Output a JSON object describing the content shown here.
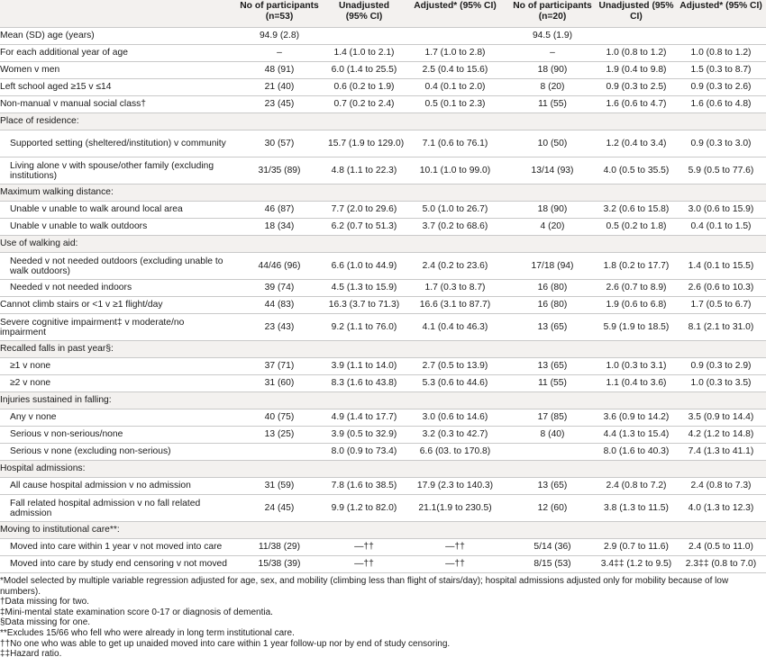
{
  "header": {
    "col1": "No of participants (n=53)",
    "col2": "Unadjusted (95% CI)",
    "col3": "Adjusted* (95% CI)",
    "col4": "No of participants (n=20)",
    "col5": "Unadjusted (95% CI)",
    "col6": "Adjusted* (95% CI)"
  },
  "rows": [
    {
      "label": "Mean (SD) age (years)",
      "type": "plain",
      "c": [
        "94.9 (2.8)",
        "",
        "",
        "94.5 (1.9)",
        "",
        ""
      ]
    },
    {
      "label": "For each additional year of age",
      "type": "plain",
      "c": [
        "–",
        "1.4 (1.0 to 2.1)",
        "1.7 (1.0 to 2.8)",
        "–",
        "1.0 (0.8 to 1.2)",
        "1.0 (0.8 to 1.2)"
      ]
    },
    {
      "label": "Women v men",
      "type": "plain",
      "c": [
        "48 (91)",
        "6.0 (1.4 to 25.5)",
        "2.5 (0.4 to 15.6)",
        "18 (90)",
        "1.9 (0.4 to 9.8)",
        "1.5 (0.3 to 8.7)"
      ]
    },
    {
      "label": "Left school aged ≥15 v ≤14",
      "type": "plain",
      "c": [
        "21 (40)",
        "0.6 (0.2 to 1.9)",
        "0.4 (0.1 to 2.0)",
        "8 (20)",
        "0.9 (0.3 to 2.5)",
        "0.9 (0.3 to 2.6)"
      ]
    },
    {
      "label": "Non-manual v manual social class†",
      "type": "plain",
      "c": [
        "23 (45)",
        "0.7 (0.2 to 2.4)",
        "0.5 (0.1 to 2.3)",
        "11 (55)",
        "1.6 (0.6 to 4.7)",
        "1.6 (0.6 to 4.8)"
      ]
    },
    {
      "label": "Place of residence:",
      "type": "section",
      "c": [
        "",
        "",
        "",
        "",
        "",
        ""
      ]
    },
    {
      "label": "Supported setting (sheltered/institution) v community",
      "type": "ind two",
      "c": [
        "30 (57)",
        "15.7 (1.9 to 129.0)",
        "7.1 (0.6 to 76.1)",
        "10 (50)",
        "1.2 (0.4 to 3.4)",
        "0.9 (0.3 to 3.0)"
      ]
    },
    {
      "label": "Living alone v with spouse/other family (excluding institutions)",
      "type": "ind two",
      "c": [
        "31/35 (89)",
        "4.8 (1.1 to 22.3)",
        "10.1 (1.0 to 99.0)",
        "13/14 (93)",
        "4.0 (0.5 to 35.5)",
        "5.9 (0.5 to 77.6)"
      ]
    },
    {
      "label": "Maximum walking distance:",
      "type": "section",
      "c": [
        "",
        "",
        "",
        "",
        "",
        ""
      ]
    },
    {
      "label": "Unable v unable to walk around local area",
      "type": "ind",
      "c": [
        "46 (87)",
        "7.7 (2.0 to 29.6)",
        "5.0 (1.0 to 26.7)",
        "18 (90)",
        "3.2 (0.6 to 15.8)",
        "3.0 (0.6 to 15.9)"
      ]
    },
    {
      "label": "Unable v unable to walk outdoors",
      "type": "ind",
      "c": [
        "18 (34)",
        "6.2 (0.7 to 51.3)",
        "3.7 (0.2 to 68.6)",
        "4 (20)",
        "0.5 (0.2 to 1.8)",
        "0.4 (0.1 to 1.5)"
      ]
    },
    {
      "label": "Use of walking aid:",
      "type": "section",
      "c": [
        "",
        "",
        "",
        "",
        "",
        ""
      ]
    },
    {
      "label": "Needed v not needed outdoors (excluding unable to walk outdoors)",
      "type": "ind two",
      "c": [
        "44/46 (96)",
        "6.6 (1.0 to 44.9)",
        "2.4 (0.2 to 23.6)",
        "17/18 (94)",
        "1.8 (0.2 to 17.7)",
        "1.4 (0.1 to 15.5)"
      ]
    },
    {
      "label": "Needed v not needed indoors",
      "type": "ind",
      "c": [
        "39 (74)",
        "4.5 (1.3 to 15.9)",
        "1.7 (0.3 to 8.7)",
        "16 (80)",
        "2.6 (0.7 to 8.9)",
        "2.6 (0.6 to 10.3)"
      ]
    },
    {
      "label": "Cannot climb stairs or <1 v ≥1 flight/day",
      "type": "plain",
      "c": [
        "44 (83)",
        "16.3 (3.7 to 71.3)",
        "16.6 (3.1 to 87.7)",
        "16 (80)",
        "1.9 (0.6 to 6.8)",
        "1.7 (0.5 to 6.7)"
      ]
    },
    {
      "label": "Severe cognitive impairment‡ v moderate/no impairment",
      "type": "plain two",
      "c": [
        "23 (43)",
        "9.2 (1.1 to 76.0)",
        "4.1 (0.4 to 46.3)",
        "13 (65)",
        "5.9 (1.9 to 18.5)",
        "8.1 (2.1 to 31.0)"
      ]
    },
    {
      "label": "Recalled falls in past year§:",
      "type": "section",
      "c": [
        "",
        "",
        "",
        "",
        "",
        ""
      ]
    },
    {
      "label": "≥1 v none",
      "type": "ind",
      "c": [
        "37 (71)",
        "3.9 (1.1 to 14.0)",
        "2.7 (0.5 to 13.9)",
        "13 (65)",
        "1.0 (0.3 to 3.1)",
        "0.9 (0.3 to 2.9)"
      ]
    },
    {
      "label": "≥2 v none",
      "type": "ind",
      "c": [
        "31 (60)",
        "8.3 (1.6 to 43.8)",
        "5.3 (0.6 to 44.6)",
        "11 (55)",
        "1.1 (0.4 to 3.6)",
        "1.0 (0.3 to 3.5)"
      ]
    },
    {
      "label": "Injuries sustained in falling:",
      "type": "section",
      "c": [
        "",
        "",
        "",
        "",
        "",
        ""
      ]
    },
    {
      "label": "Any v none",
      "type": "ind",
      "c": [
        "40 (75)",
        "4.9 (1.4 to 17.7)",
        "3.0 (0.6 to 14.6)",
        "17 (85)",
        "3.6 (0.9 to 14.2)",
        "3.5 (0.9 to 14.4)"
      ]
    },
    {
      "label": "Serious v non-serious/none",
      "type": "ind",
      "c": [
        "13 (25)",
        "3.9 (0.5 to 32.9)",
        "3.2 (0.3 to 42.7)",
        "8 (40)",
        "4.4 (1.3 to 15.4)",
        "4.2 (1.2 to 14.8)"
      ]
    },
    {
      "label": "Serious v none (excluding non-serious)",
      "type": "ind",
      "c": [
        "",
        "8.0 (0.9 to 73.4)",
        "6.6 (03. to 170.8)",
        "",
        "8.0 (1.6 to 40.3)",
        "7.4 (1.3 to 41.1)"
      ]
    },
    {
      "label": "Hospital admissions:",
      "type": "section",
      "c": [
        "",
        "",
        "",
        "",
        "",
        ""
      ]
    },
    {
      "label": "All cause hospital admission v no admission",
      "type": "ind",
      "c": [
        "31 (59)",
        "7.8 (1.6 to 38.5)",
        "17.9 (2.3 to 140.3)",
        "13 (65)",
        "2.4 (0.8 to 7.2)",
        "2.4 (0.8 to 7.3)"
      ]
    },
    {
      "label": "Fall related hospital admission v no fall related admission",
      "type": "ind two",
      "c": [
        "24 (45)",
        "9.9 (1.2 to 82.0)",
        "21.1(1.9 to 230.5)",
        "12 (60)",
        "3.8 (1.3 to 11.5)",
        "4.0 (1.3 to 12.3)"
      ]
    },
    {
      "label": "Moving to institutional care**:",
      "type": "section",
      "c": [
        "",
        "",
        "",
        "",
        "",
        ""
      ]
    },
    {
      "label": "Moved into care within 1 year v not moved into care",
      "type": "ind",
      "c": [
        "11/38 (29)",
        "—††",
        "—††",
        "5/14 (36)",
        "2.9 (0.7 to 11.6)",
        "2.4 (0.5 to 11.0)"
      ]
    },
    {
      "label": "Moved into care by study end censoring v not moved",
      "type": "ind last",
      "c": [
        "15/38 (39)",
        "—††",
        "—††",
        "8/15 (53)",
        "3.4‡‡ (1.2 to 9.5)",
        "2.3‡‡ (0.8 to 7.0)"
      ]
    }
  ],
  "notes": [
    "*Model selected by multiple variable regression adjusted for age, sex, and mobility (climbing less than flight of stairs/day); hospital admissions adjusted only for mobility because of low numbers).",
    "†Data missing for two.",
    "‡Mini-mental state examination score 0-17 or diagnosis of dementia.",
    "§Data missing for one.",
    "**Excludes 15/66 who fell who were already in long term institutional care.",
    "††No one who was able to get up unaided moved into care within 1 year follow-up nor by end of study censoring.",
    "‡‡Hazard ratio."
  ]
}
